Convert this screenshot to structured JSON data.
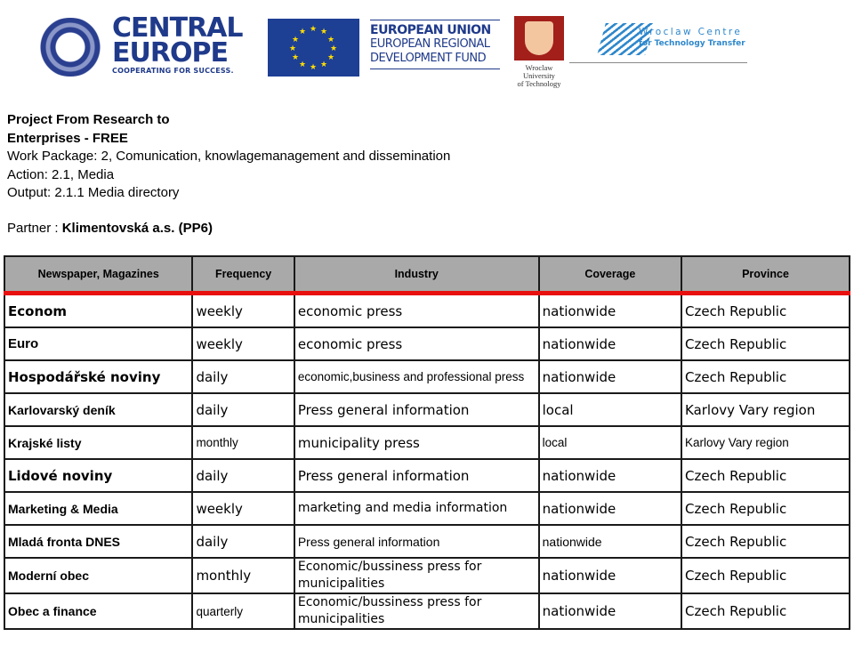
{
  "logos": {
    "central_europe": {
      "line1": "CENTRAL",
      "line2": "EUROPE",
      "tagline": "COOPERATING FOR SUCCESS."
    },
    "eu": {
      "line1": "EUROPEAN UNION",
      "line2": "EUROPEAN REGIONAL",
      "line3": "DEVELOPMENT FUND"
    },
    "wroclaw_university": {
      "line1": "Wroclaw",
      "line2": "University",
      "line3": "of Technology"
    },
    "wctt": {
      "line1": "Wroclaw Centre",
      "line2": "for Technology Transfer"
    },
    "colors": {
      "ce_blue": "#1f3a8a",
      "eu_flag": "#1d3f94",
      "eu_star": "#ffdd00",
      "wut_red": "#a31f1a",
      "wctt_blue": "#2f88cc"
    }
  },
  "header": {
    "project_line1": "Project From Research to",
    "project_line2": "Enterprises - FREE",
    "work_package": "Work Package: 2, Comunication, knowlagemanagement and dissemination",
    "action": "Action: 2.1, Media",
    "output": "Output: 2.1.1 Media directory",
    "partner_label": "Partner : ",
    "partner_name": "Klimentovská a.s. (PP6)"
  },
  "table": {
    "header_bg": "#a9a9a9",
    "header_rule_color": "#e8100f",
    "columns": [
      "Newspaper, Magazines",
      "Frequency",
      "Industry",
      "Coverage",
      "Province"
    ],
    "rows": [
      {
        "name": "Econom",
        "frequency": "weekly",
        "industry": "economic press",
        "coverage": "nationwide",
        "province": "Czech Republic"
      },
      {
        "name": "Euro",
        "frequency": "weekly",
        "industry": "economic press",
        "coverage": "nationwide",
        "province": "Czech Republic"
      },
      {
        "name": "Hospodářské noviny",
        "frequency": "daily",
        "industry": "economic,business and professional press",
        "coverage": "nationwide",
        "province": "Czech Republic"
      },
      {
        "name": "Karlovarský deník",
        "frequency": "daily",
        "industry": "Press general information",
        "coverage": "local",
        "province": "Karlovy Vary region"
      },
      {
        "name": "Krajské listy",
        "frequency": "monthly",
        "industry": "municipality press",
        "coverage": "local",
        "province": "Karlovy Vary region"
      },
      {
        "name": "Lidové noviny",
        "frequency": "daily",
        "industry": "Press general information",
        "coverage": "nationwide",
        "province": "Czech Republic"
      },
      {
        "name": "Marketing & Media",
        "frequency": "weekly",
        "industry": "marketing and media information",
        "coverage": "nationwide",
        "province": "Czech Republic"
      },
      {
        "name": "Mladá fronta DNES",
        "frequency": "daily",
        "industry": "Press general information",
        "coverage": "nationwide",
        "province": "Czech Republic"
      },
      {
        "name": "Moderní obec",
        "frequency": "monthly",
        "industry": "Economic/bussiness press for municipalities",
        "coverage": "nationwide",
        "province": "Czech Republic"
      },
      {
        "name": "Obec a finance",
        "frequency": "quarterly",
        "industry": "Economic/bussiness press for municipalities",
        "coverage": "nationwide",
        "province": "Czech Republic"
      }
    ]
  }
}
